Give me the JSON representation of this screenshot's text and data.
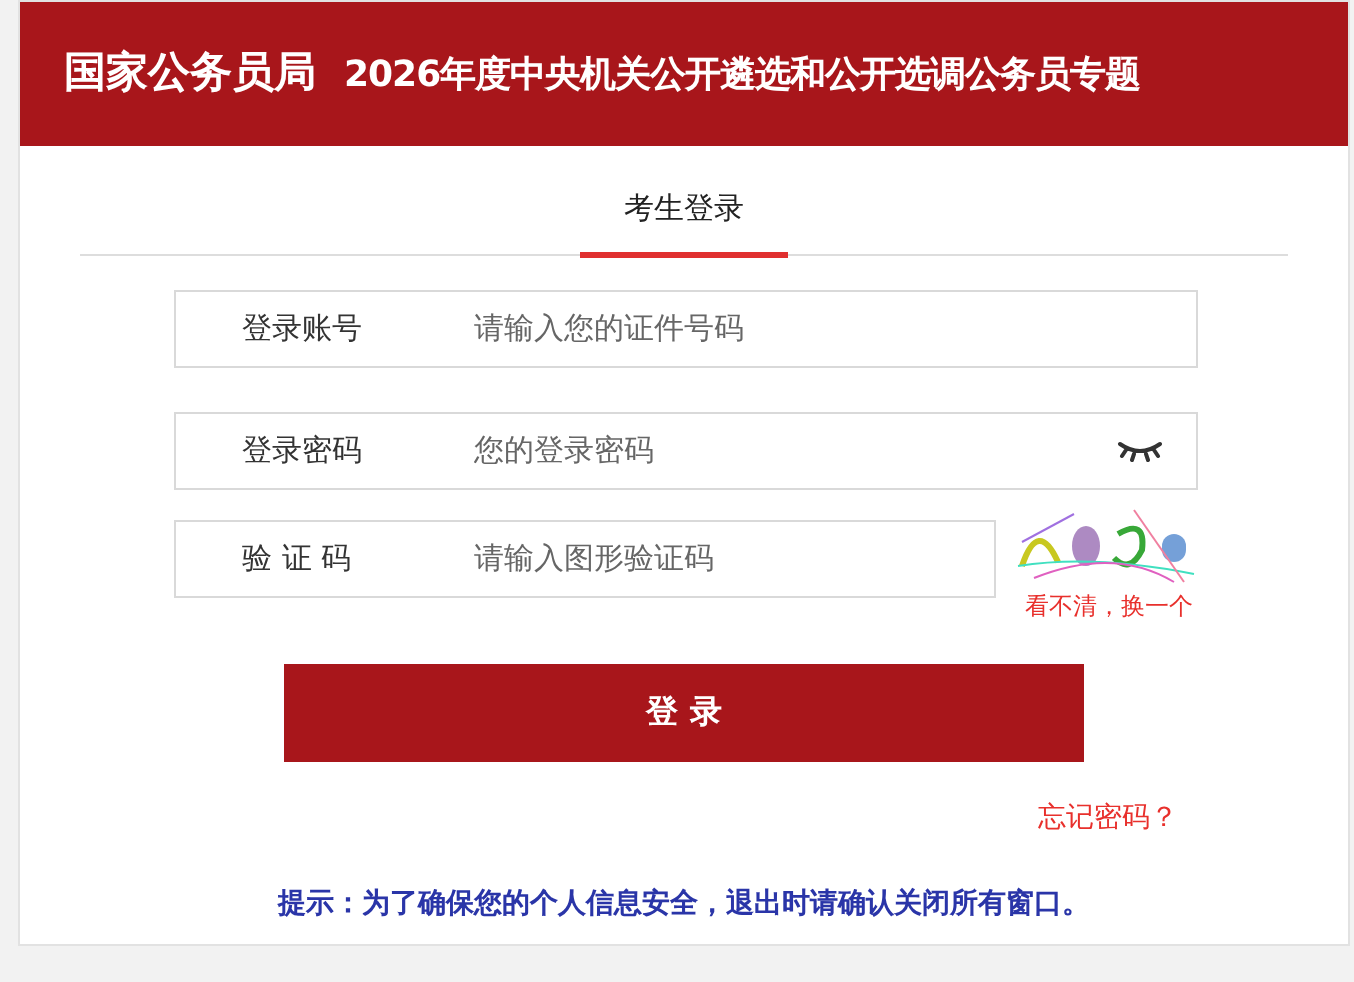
{
  "header": {
    "logo": "国家公务员局",
    "title": "2026年度中央机关公开遴选和公开选调公务员专题"
  },
  "tabs": [
    {
      "label": "考生登录",
      "selected": true
    }
  ],
  "fields": [
    {
      "kind": "text",
      "label": "登录账号",
      "placeholder": "请输入您的证件号码"
    },
    {
      "kind": "password",
      "label": "登录密码",
      "placeholder": "您的登录密码"
    },
    {
      "kind": "captcha",
      "label": "验 证 码",
      "placeholder": "请输入图形验证码",
      "refresh_link": "看不清，换一个"
    }
  ],
  "login_button": "登 录",
  "forgot_link": "忘记密码？",
  "notice": "提示：为了确保您的个人信息安全，退出时请确认关闭所有窗口。"
}
